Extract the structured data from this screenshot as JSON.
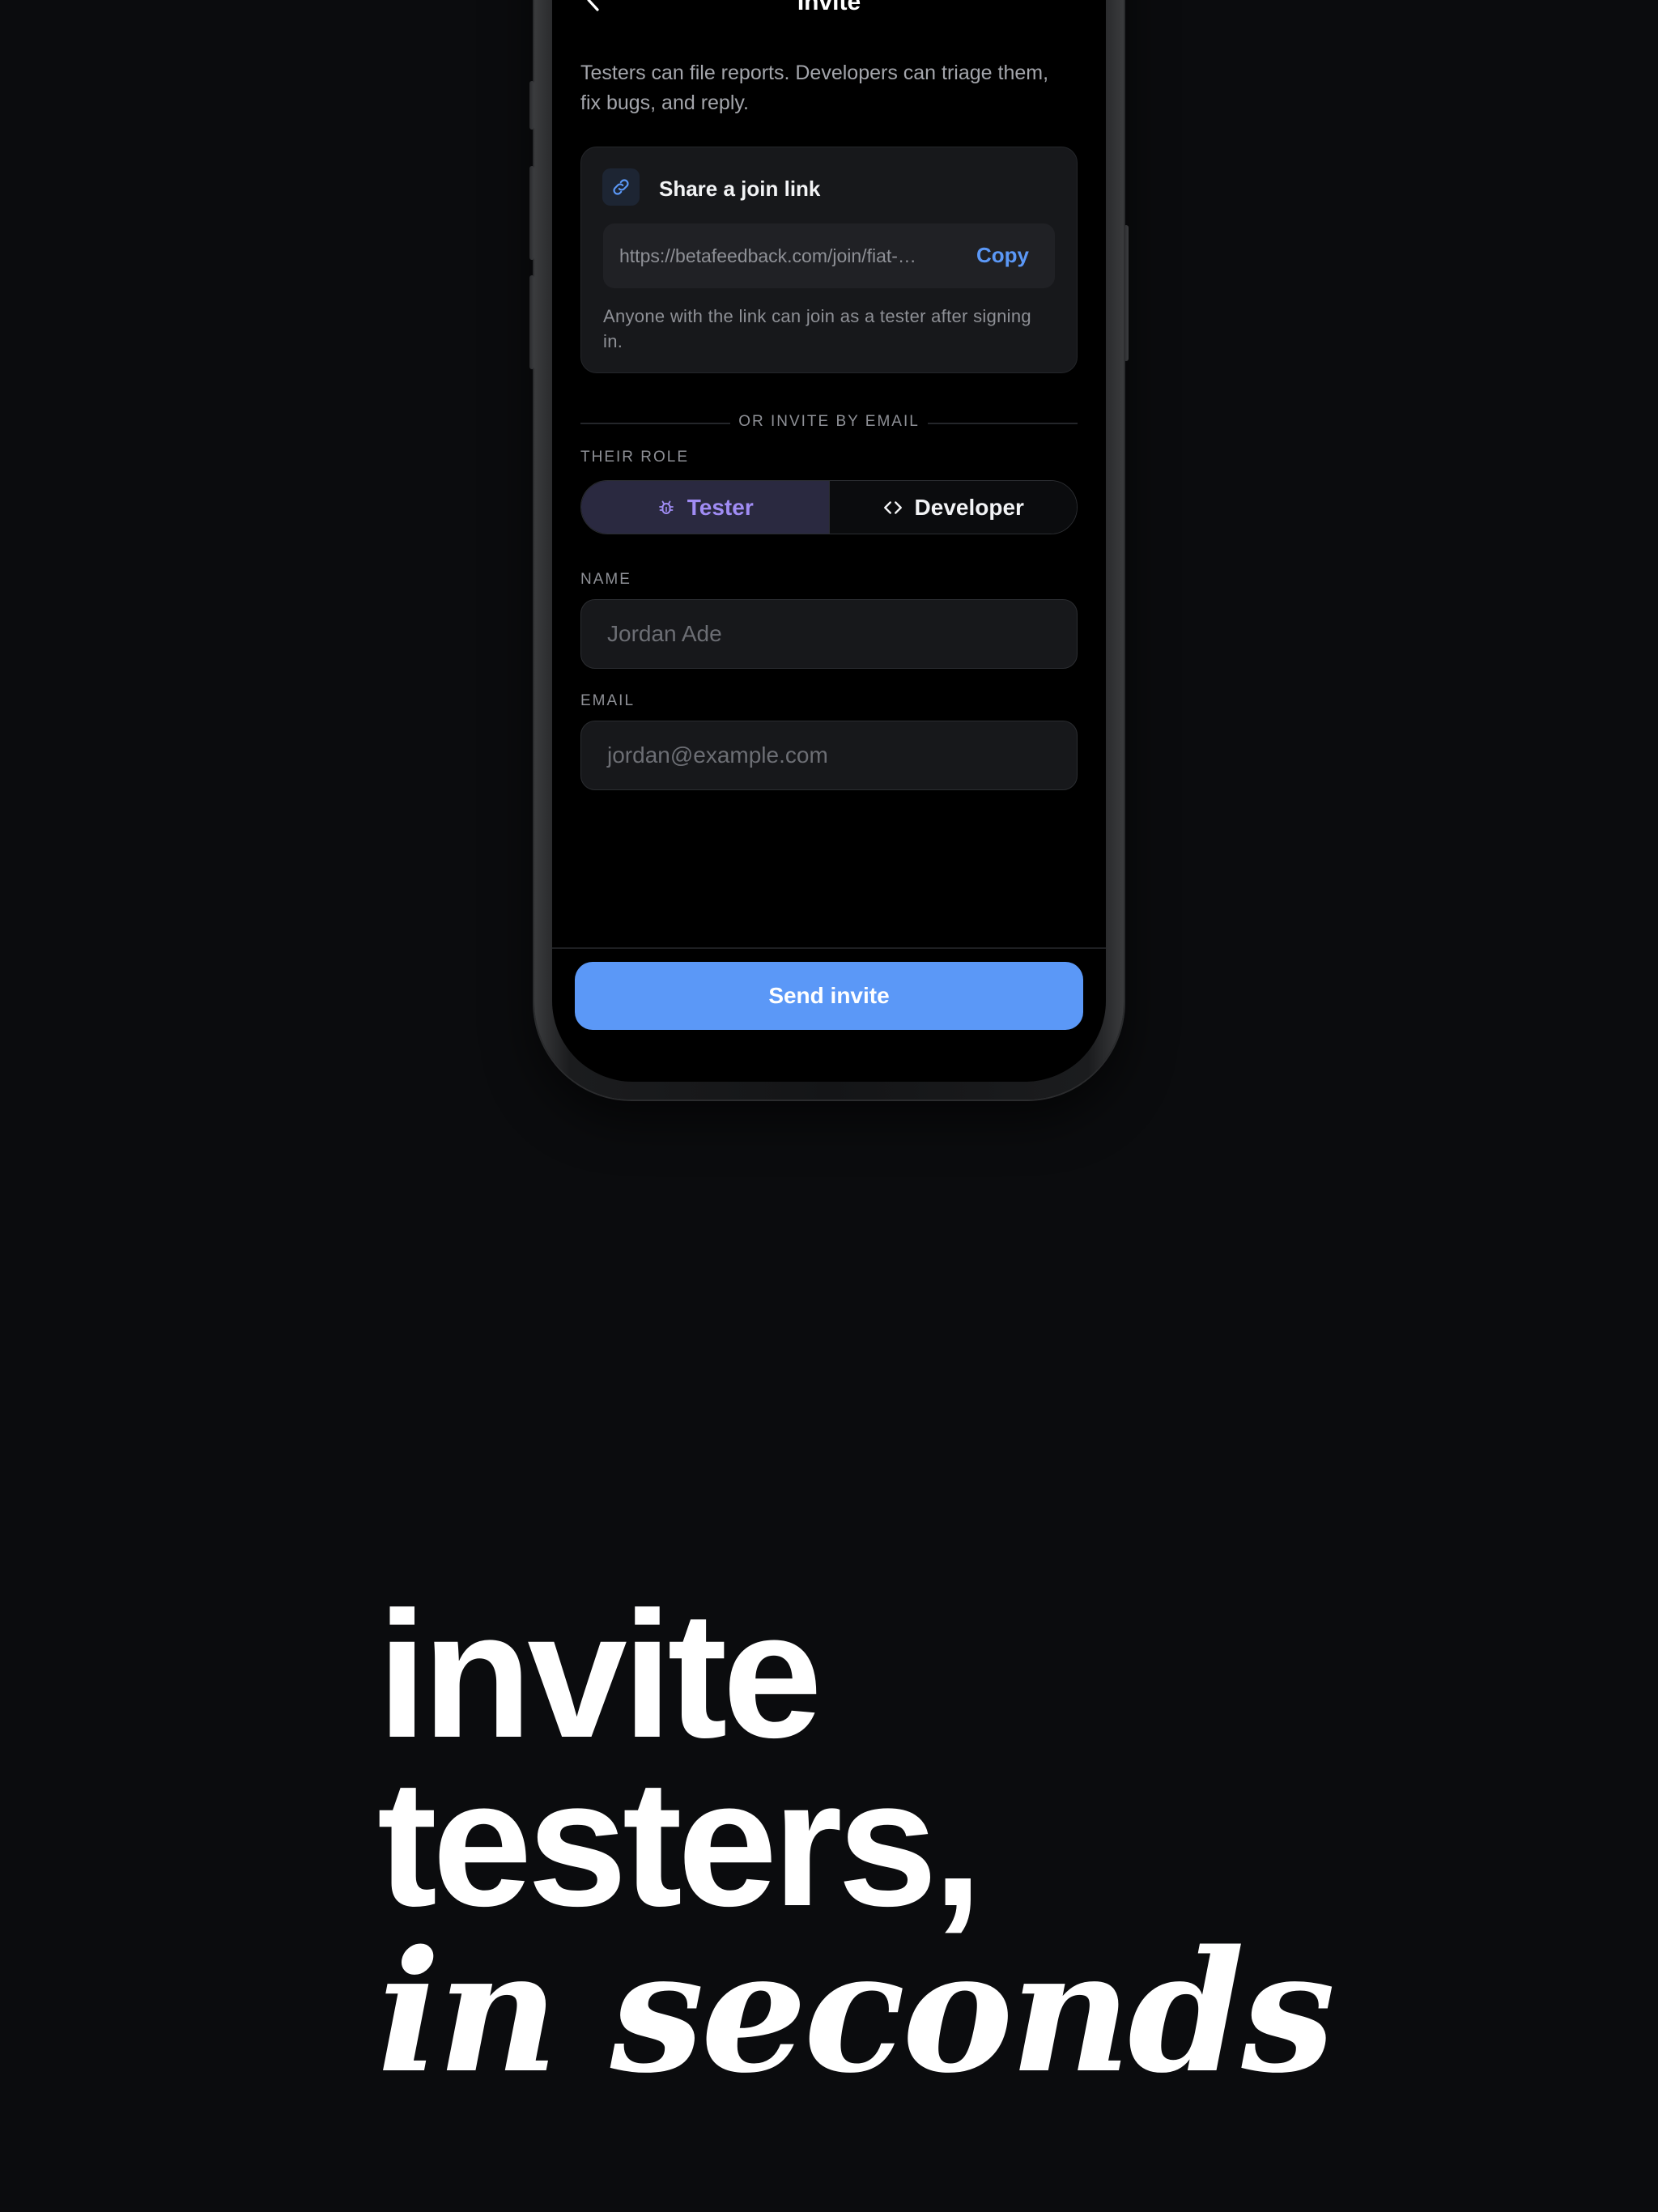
{
  "screen": {
    "nav": {
      "title": "Invite"
    },
    "intro": "Testers can file reports. Developers can triage them, fix bugs, and reply.",
    "join_link": {
      "title": "Share a join link",
      "url": "https://betafeedback.com/join/fiat-…",
      "copy_label": "Copy",
      "help": "Anyone with the link can join as a tester after signing in."
    },
    "divider_label": "OR INVITE BY EMAIL",
    "role": {
      "label": "THEIR ROLE",
      "options": [
        "Tester",
        "Developer"
      ],
      "selected": "Tester"
    },
    "name": {
      "label": "NAME",
      "placeholder": "Jordan Ade"
    },
    "email": {
      "label": "EMAIL",
      "placeholder": "jordan@example.com"
    },
    "send_button": "Send invite"
  },
  "headline": {
    "line1": "invite",
    "line2": "testers,",
    "line3": "in seconds"
  },
  "icons": {
    "back": "chevron-left-icon",
    "link": "link-icon",
    "tester": "bug-icon",
    "developer": "code-icon"
  },
  "colors": {
    "background": "#0b0c0e",
    "accent": "#5b98f7",
    "tester_accent": "#a08cf4",
    "segment_active_bg": "#2a2940"
  }
}
